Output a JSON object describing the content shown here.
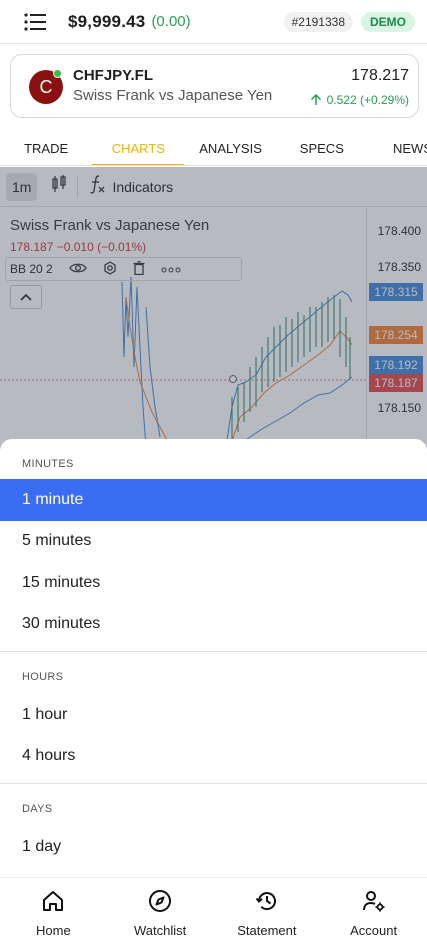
{
  "header": {
    "balance": "$9,999.43",
    "balance_change": "(0.00)",
    "account_id": "#2191338",
    "mode_badge": "DEMO"
  },
  "instrument": {
    "logo_letter": "C",
    "symbol": "CHFJPY.FL",
    "description": "Swiss Frank vs Japanese Yen",
    "price": "178.217",
    "change": "0.522 (+0.29%)",
    "change_color": "#2a9d53"
  },
  "tabs": [
    {
      "label": "TRADE",
      "active": false
    },
    {
      "label": "CHARTS",
      "active": true
    },
    {
      "label": "ANALYSIS",
      "active": false
    },
    {
      "label": "SPECS",
      "active": false
    },
    {
      "label": "NEWS",
      "active": false
    }
  ],
  "chart": {
    "timeframe_button": "1m",
    "indicators_label": "Indicators",
    "title": "Swiss Frank vs Japanese Yen",
    "quote": "178.187 −0.010 (−0.01%)",
    "indicator_label": "BB 20 2",
    "axis_labels": [
      "178.400",
      "178.350",
      "178.150"
    ],
    "tags": [
      {
        "value": "178.315",
        "color": "#4a90d9"
      },
      {
        "value": "178.254",
        "color": "#f08a3c"
      },
      {
        "value": "178.192",
        "color": "#4a90d9"
      },
      {
        "value": "178.187",
        "color": "#e05555"
      }
    ]
  },
  "timeframe_sheet": {
    "sections": [
      {
        "title": "MINUTES",
        "options": [
          "1 minute",
          "5 minutes",
          "15 minutes",
          "30 minutes"
        ]
      },
      {
        "title": "HOURS",
        "options": [
          "1 hour",
          "4 hours"
        ]
      },
      {
        "title": "DAYS",
        "options": [
          "1 day"
        ]
      }
    ],
    "selected": "1 minute",
    "accent_color": "#3a6cf4"
  },
  "bottom_nav": [
    {
      "label": "Home",
      "icon": "home-icon"
    },
    {
      "label": "Watchlist",
      "icon": "compass-icon"
    },
    {
      "label": "Statement",
      "icon": "history-icon"
    },
    {
      "label": "Account",
      "icon": "account-settings-icon"
    }
  ]
}
